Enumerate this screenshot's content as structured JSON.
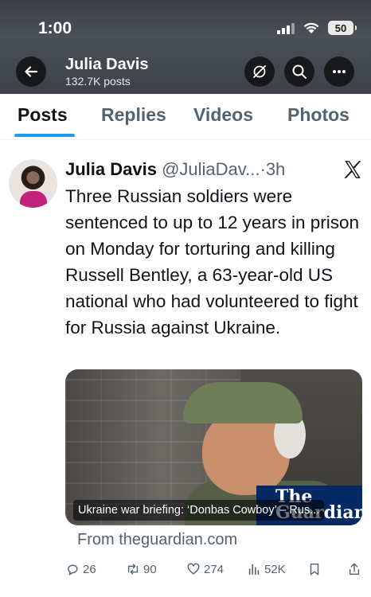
{
  "status_bar": {
    "time": "1:00",
    "battery": "50"
  },
  "header": {
    "name": "Julia Davis",
    "posts_count": "132.7K posts"
  },
  "tabs": [
    {
      "label": "Posts",
      "active": true
    },
    {
      "label": "Replies",
      "active": false
    },
    {
      "label": "Videos",
      "active": false
    },
    {
      "label": "Photos",
      "active": false
    }
  ],
  "tweet": {
    "name": "Julia Davis",
    "handle": "@JuliaDav...",
    "dot": "·",
    "time": "3h",
    "text": "Three Russian soldiers were sentenced to up to 12 years in prison on Monday for torturing and killing Russell Bentley, a 63-year-old US national who had volunteered to fight for Russia against Ukraine.",
    "card": {
      "caption": "Ukraine war briefing: ‘Donbas Cowboy’ – Rus...",
      "logo_text": "The Guardian",
      "source": "From theguardian.com"
    },
    "actions": {
      "replies": "26",
      "reposts": "90",
      "likes": "274",
      "views": "52K"
    }
  },
  "colors": {
    "accent": "#1d9bf0",
    "text_primary": "#0f1419",
    "text_secondary": "#536471",
    "guardian_blue": "#052962"
  }
}
